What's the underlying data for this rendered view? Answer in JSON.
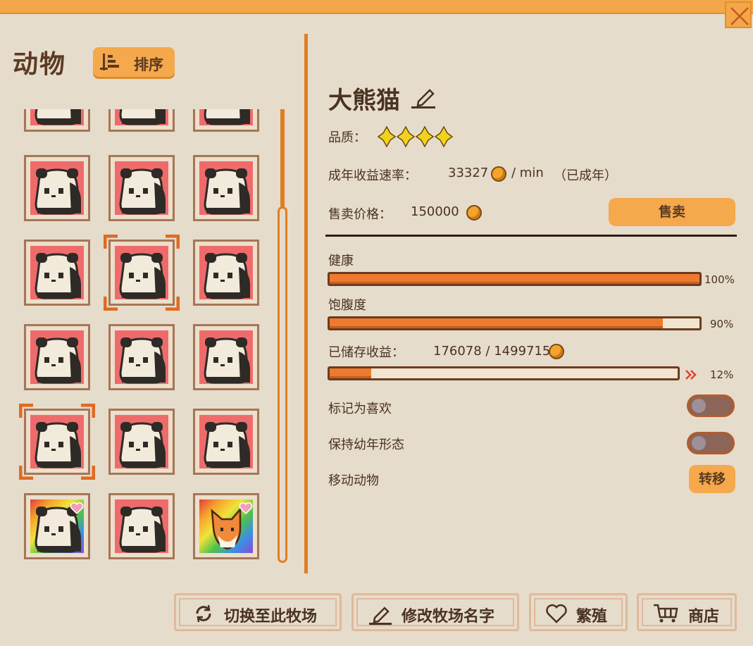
{
  "header": {
    "title": "动物",
    "sort_label": "排序"
  },
  "grid": {
    "cells": [
      {
        "bg": "red",
        "animal": "panda"
      },
      {
        "bg": "red",
        "animal": "panda"
      },
      {
        "bg": "red",
        "animal": "panda"
      },
      {
        "bg": "red",
        "animal": "panda"
      },
      {
        "bg": "red",
        "animal": "panda"
      },
      {
        "bg": "red",
        "animal": "panda"
      },
      {
        "bg": "red",
        "animal": "panda"
      },
      {
        "bg": "red",
        "animal": "panda",
        "selected": true
      },
      {
        "bg": "red",
        "animal": "panda"
      },
      {
        "bg": "red",
        "animal": "panda"
      },
      {
        "bg": "red",
        "animal": "panda"
      },
      {
        "bg": "red",
        "animal": "panda"
      },
      {
        "bg": "red",
        "animal": "panda",
        "selected": true
      },
      {
        "bg": "red",
        "animal": "panda"
      },
      {
        "bg": "red",
        "animal": "panda"
      },
      {
        "bg": "rainbow",
        "animal": "panda",
        "heart": true
      },
      {
        "bg": "red",
        "animal": "panda"
      },
      {
        "bg": "rainbow",
        "animal": "fox",
        "heart": true
      }
    ]
  },
  "detail": {
    "name": "大熊猫",
    "quality_label": "品质：",
    "quality_stars": 4,
    "rate_label": "成年收益速率：",
    "rate_value": "33327",
    "rate_unit": "/ min",
    "rate_status": "（已成年）",
    "price_label": "售卖价格：",
    "price_value": "150000",
    "sell_label": "售卖",
    "health_label": "健康",
    "health_value": 100,
    "health_pct": "100%",
    "satiety_label": "饱腹度",
    "satiety_value": 90,
    "satiety_pct": "90%",
    "stored_label": "已储存收益：",
    "stored_value": "176078 / 1499715",
    "stored_fraction": 12,
    "stored_pct": "12%",
    "favorite_label": "标记为喜欢",
    "keep_young_label": "保持幼年形态",
    "move_label": "移动动物",
    "move_button": "转移"
  },
  "footer": {
    "switch_label": "切换至此牧场",
    "rename_label": "修改牧场名字",
    "breed_label": "繁殖",
    "shop_label": "商店"
  },
  "colors": {
    "accent": "#f5a84c",
    "bar_fill": "#ee7a2f",
    "panel_bg": "#e6dccb"
  }
}
